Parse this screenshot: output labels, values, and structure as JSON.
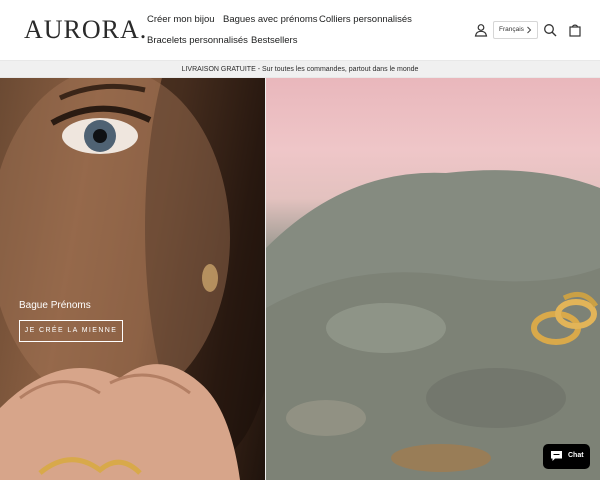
{
  "header": {
    "logo": "AURORA.",
    "nav": [
      {
        "label": "Créer mon bijou"
      },
      {
        "label": "Bagues avec prénoms"
      },
      {
        "label": "Colliers personnalisés"
      },
      {
        "label": "Bracelets personnalisés"
      },
      {
        "label": "Bestsellers"
      }
    ],
    "language": "Français",
    "icons": [
      "account-icon",
      "chevron-right-icon",
      "search-icon",
      "cart-icon"
    ]
  },
  "announcement": "LIVRAISON GRATUITE - Sur toutes les commandes, partout dans le monde",
  "hero": {
    "caption": "Bague Prénoms",
    "button_label": "JE CRÉE LA MIENNE"
  },
  "chat": {
    "label": "Chat"
  },
  "colors": {
    "text": "#1c1d1d",
    "announcement_bg": "#f0f0f0",
    "chat_bg": "#000000"
  }
}
